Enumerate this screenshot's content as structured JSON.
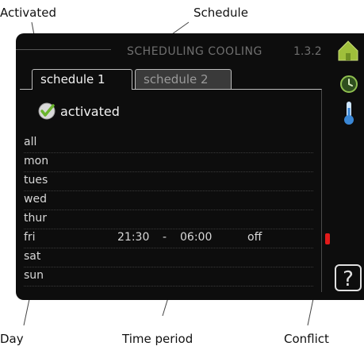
{
  "callouts": {
    "activated": "Activated",
    "schedule": "Schedule",
    "day": "Day",
    "time_period": "Time period",
    "conflict": "Conflict"
  },
  "screen": {
    "title": "SCHEDULING COOLING",
    "menu_number": "1.3.2",
    "tabs": [
      {
        "label": "schedule 1",
        "active": true
      },
      {
        "label": "schedule 2",
        "active": false
      }
    ],
    "activated_label": "activated",
    "days": [
      {
        "name": "all",
        "start": "",
        "sep": "",
        "end": "",
        "mode": ""
      },
      {
        "name": "mon",
        "start": "",
        "sep": "",
        "end": "",
        "mode": ""
      },
      {
        "name": "tues",
        "start": "",
        "sep": "",
        "end": "",
        "mode": ""
      },
      {
        "name": "wed",
        "start": "",
        "sep": "",
        "end": "",
        "mode": ""
      },
      {
        "name": "thur",
        "start": "",
        "sep": "",
        "end": "",
        "mode": ""
      },
      {
        "name": "fri",
        "start": "21:30",
        "sep": "-",
        "end": "06:00",
        "mode": "off"
      },
      {
        "name": "sat",
        "start": "",
        "sep": "",
        "end": "",
        "mode": ""
      },
      {
        "name": "sun",
        "start": "",
        "sep": "",
        "end": "",
        "mode": ""
      }
    ],
    "help_glyph": "?"
  },
  "colors": {
    "screen_bg": "#0d0d0d",
    "check_green": "#6ab42d",
    "conflict_red": "#e21a1a",
    "house_green": "#9fbf3b"
  }
}
